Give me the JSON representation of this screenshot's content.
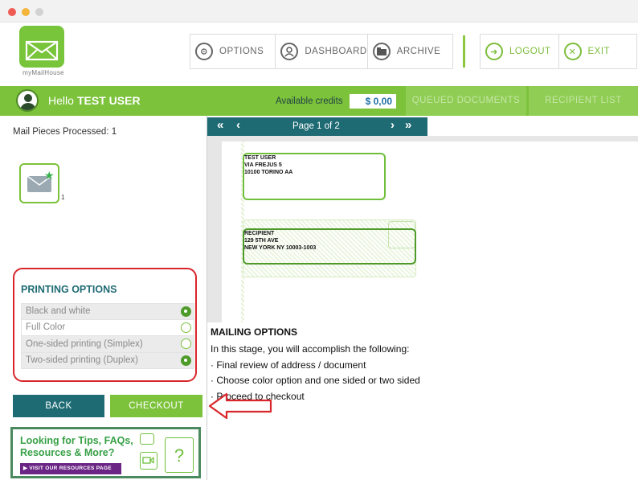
{
  "window": {
    "controls": [
      "close",
      "minimize",
      "zoom"
    ]
  },
  "header": {
    "logo_text": "myMailHouse",
    "nav": [
      {
        "label": "OPTIONS",
        "icon": "gear-icon"
      },
      {
        "label": "DASHBOARD",
        "icon": "user-icon"
      },
      {
        "label": "ARCHIVE",
        "icon": "archive-icon"
      }
    ],
    "nav_right": [
      {
        "label": "LOGOUT",
        "icon": "logout-arrow-icon"
      },
      {
        "label": "EXIT",
        "icon": "close-circle-icon"
      }
    ]
  },
  "userbar": {
    "hello": "Hello",
    "username": "TEST USER",
    "credits_label": "Available credits",
    "credits_value": "$ 0,00",
    "tabs": [
      "QUEUED DOCUMENTS",
      "RECIPIENT LIST"
    ]
  },
  "left": {
    "processed": "Mail Pieces Processed: 1",
    "mail_count": "1",
    "printing_title": "PRINTING OPTIONS",
    "printing_options": [
      {
        "label": "Black and white",
        "selected": true
      },
      {
        "label": "Full Color",
        "selected": false
      },
      {
        "label": "One-sided printing (Simplex)",
        "selected": false
      },
      {
        "label": "Two-sided printing (Duplex)",
        "selected": true
      }
    ],
    "back_label": "BACK",
    "checkout_label": "CHECKOUT",
    "promo": {
      "line1": "Looking for Tips, FAQs,",
      "line2": "Resources & More?",
      "button": "▶ VISIT OUR RESOURCES PAGE",
      "question_mark": "?"
    }
  },
  "viewer": {
    "first": "«",
    "prev": "‹",
    "next": "›",
    "last": "»",
    "page_label": "Page 1  of 2",
    "sender": [
      "TEST USER",
      "VIA FREJUS 5",
      "10100 TORINO AA"
    ],
    "recipient": [
      "RECIPIENT",
      "129 5TH AVE",
      "NEW YORK NY 10003-1003"
    ]
  },
  "mailing": {
    "title": "MAILING OPTIONS",
    "intro": "In this stage, you will accomplish the following:",
    "bullets": [
      "· Final review of address / document",
      "· Choose color option and one sided or two sided",
      "· Proceed to checkout"
    ]
  },
  "colors": {
    "brand_green": "#7cc23b",
    "teal": "#1f6b74",
    "highlight_red": "#d9262a"
  }
}
